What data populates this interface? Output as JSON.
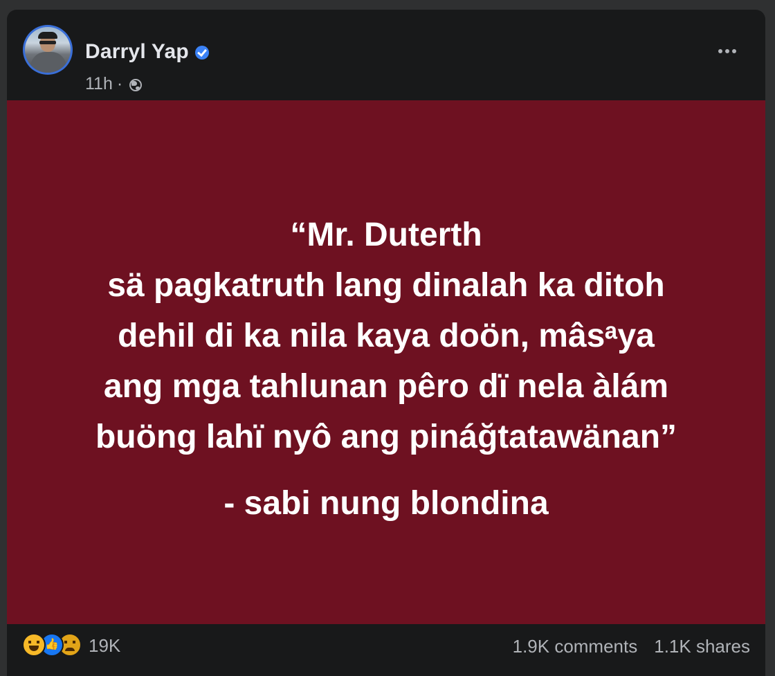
{
  "post": {
    "author": "Darryl Yap",
    "time": "11h",
    "separator": "·",
    "verified": true,
    "privacy_icon": "globe-icon",
    "more_icon": "more-options-icon"
  },
  "quote": {
    "background_color": "#6e1121",
    "lines": [
      "“Mr. Duterth",
      "sä pagkatruth lang dinalah ka ditoh",
      "dehil di ka nila kaya doön, mâsᵃya",
      "ang mga tahlunan pêro dï nela àlám",
      "buöng lahï nyô ang pináğtatawänan”"
    ],
    "attribution": "- sabi nung blondina"
  },
  "engagement": {
    "reactions": [
      "haha",
      "like",
      "sad"
    ],
    "reaction_count": "19K",
    "comments": "1.9K comments",
    "shares": "1.1K shares"
  }
}
